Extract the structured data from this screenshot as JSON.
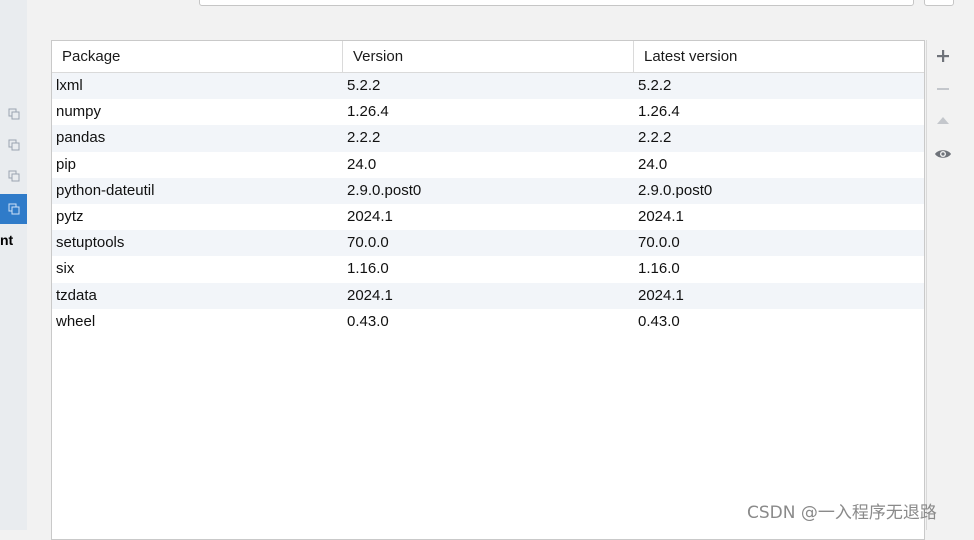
{
  "sidebar": {
    "partial_label": "nt",
    "icon_name": "copy-icon"
  },
  "table": {
    "columns": [
      "Package",
      "Version",
      "Latest version"
    ],
    "rows": [
      {
        "package": "lxml",
        "version": "5.2.2",
        "latest": "5.2.2"
      },
      {
        "package": "numpy",
        "version": "1.26.4",
        "latest": "1.26.4"
      },
      {
        "package": "pandas",
        "version": "2.2.2",
        "latest": "2.2.2"
      },
      {
        "package": "pip",
        "version": "24.0",
        "latest": "24.0"
      },
      {
        "package": "python-dateutil",
        "version": "2.9.0.post0",
        "latest": "2.9.0.post0"
      },
      {
        "package": "pytz",
        "version": "2024.1",
        "latest": "2024.1"
      },
      {
        "package": "setuptools",
        "version": "70.0.0",
        "latest": "70.0.0"
      },
      {
        "package": "six",
        "version": "1.16.0",
        "latest": "1.16.0"
      },
      {
        "package": "tzdata",
        "version": "2024.1",
        "latest": "2024.1"
      },
      {
        "package": "wheel",
        "version": "0.43.0",
        "latest": "0.43.0"
      }
    ]
  },
  "toolbar": {
    "buttons": [
      {
        "name": "add-package-button",
        "icon": "plus-icon",
        "enabled": true
      },
      {
        "name": "remove-package-button",
        "icon": "minus-icon",
        "enabled": false
      },
      {
        "name": "upgrade-package-button",
        "icon": "triangle-up-icon",
        "enabled": false
      },
      {
        "name": "show-early-releases-button",
        "icon": "eye-icon",
        "enabled": true
      }
    ]
  },
  "watermark": {
    "text": "CSDN @一入程序无退路"
  },
  "colors": {
    "selected_sidebar": "#2f7bc9",
    "row_stripe": "#f2f5f9",
    "icon_gray": "#6f737a",
    "icon_disabled": "#c4c7cc"
  }
}
